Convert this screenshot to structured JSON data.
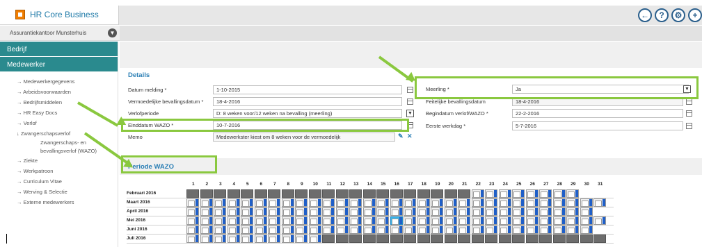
{
  "header": {
    "app_title": "HR Core Business",
    "company": "Assurantiekantoor Munsterhuis"
  },
  "top_icons": [
    "back-arrow-icon",
    "help-icon",
    "settings-icon",
    "add-icon"
  ],
  "sidebar": {
    "group1": "Bedrijf",
    "group2": "Medewerker",
    "items": [
      "→ Medewerkergegevens",
      "→ Arbeidsvoorwaarden",
      "→ Bedrijfsmiddelen",
      "→ HR Easy Docs",
      "→ Verlof",
      "↓ Zwangerschapsverlof",
      "Zwangerschaps- en",
      "bevallingsverlof (WAZO)",
      "→ Ziekte",
      "→ Werkpatroon",
      "→ Curriculum Vitae",
      "→ Werving & Selectie",
      "→ Externe medewerkers"
    ]
  },
  "details": {
    "title": "Details",
    "left": [
      {
        "label": "Datum melding *",
        "value": "1-10-2015"
      },
      {
        "label": "Vermoedelijke bevallingsdatum *",
        "value": "18-4-2016"
      },
      {
        "label": "Verlofperiode",
        "value": "D: 8 weken voor/12 weken na bevalling (meerling)"
      },
      {
        "label": "Einddatum WAZO *",
        "value": "10-7-2016"
      },
      {
        "label": "Memo",
        "value": "Medewerkster kiest om 8 weken voor de vermoedelijk"
      }
    ],
    "right": [
      {
        "label": "Meerling *",
        "value": "Ja"
      },
      {
        "label": "Feitelijke bevallingsdatum",
        "value": "18-4-2016"
      },
      {
        "label": "Begindatum verlof/WAZO *",
        "value": "22-2-2016"
      },
      {
        "label": "Eerste werkdag *",
        "value": "5-7-2016"
      }
    ]
  },
  "periode": {
    "title": "Periode WAZO",
    "days": [
      "1",
      "2",
      "3",
      "4",
      "5",
      "6",
      "7",
      "8",
      "9",
      "10",
      "11",
      "12",
      "13",
      "14",
      "15",
      "16",
      "17",
      "18",
      "19",
      "20",
      "21",
      "22",
      "23",
      "24",
      "25",
      "26",
      "27",
      "28",
      "29",
      "30",
      "31"
    ],
    "months": [
      {
        "name": "Februari 2016",
        "pattern": "DDDDDDDDDDDDDDDDDDDDDWWWWWWWW__"
      },
      {
        "name": "Maart 2016",
        "pattern": "WWWWWWWWWWWWWWWWWWWWWWWWWWWWWWW"
      },
      {
        "name": "April 2016",
        "pattern": "WWWWWWWWWWWWWWWWWWWWWWWWWWWWWW_"
      },
      {
        "name": "Mei 2016",
        "pattern": "WWWWWWWWWWWWWWWCWWWWWWWWWWWWWWW"
      },
      {
        "name": "Juni 2016",
        "pattern": "WWWWWWWWWWWWWWWWWWWWWWWWWWWWWW_"
      },
      {
        "name": "Juli 2016",
        "pattern": "WWWWWWWWWWDDDDDDDDDDDDDDDDDDDDD"
      }
    ]
  },
  "colors": {
    "accent": "#2a8a8e",
    "title_blue": "#2b7fb5",
    "highlight_green": "#8ac83f",
    "leave_blue": "#1f5fc8",
    "selected_day": "#35b6ee",
    "inactive_day": "#6d6d6d"
  }
}
